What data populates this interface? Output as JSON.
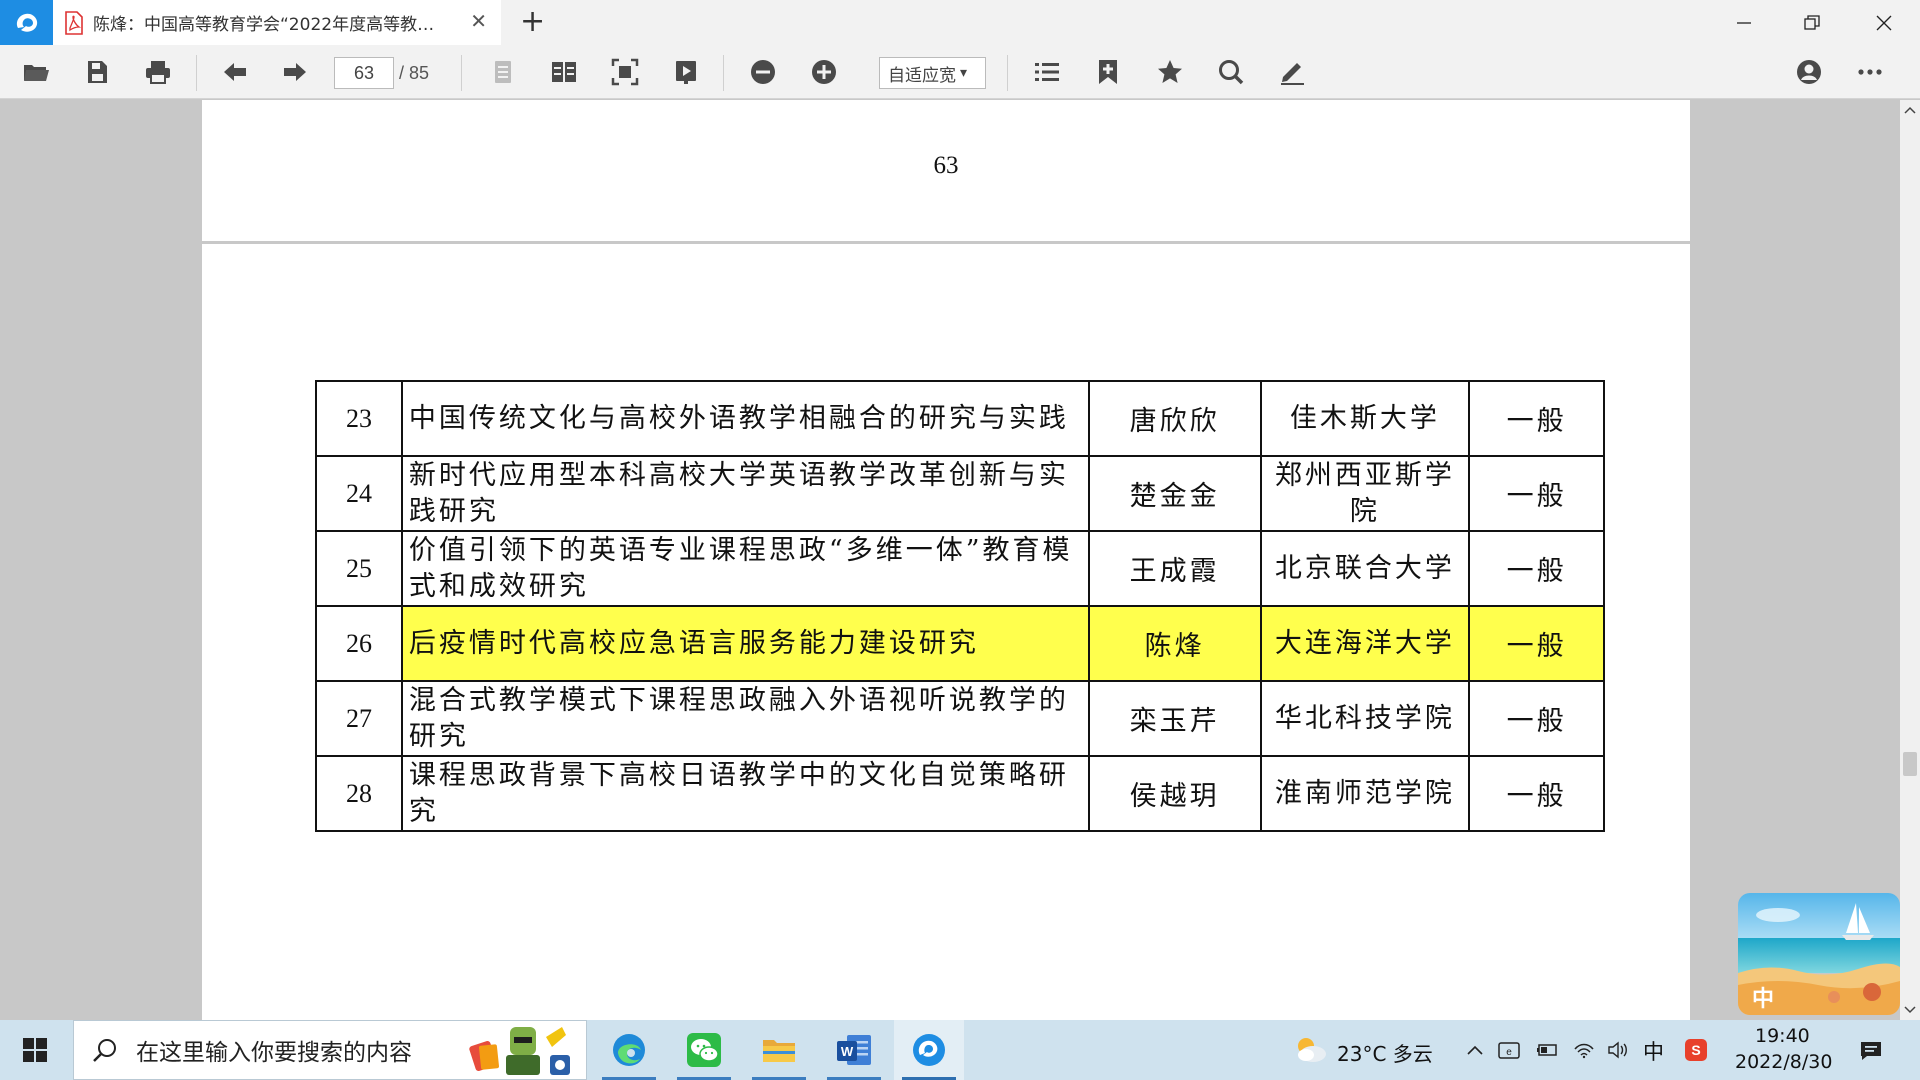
{
  "tab": {
    "title": "陈烽：中国高等教育学会“2022年度高等教…"
  },
  "toolbar": {
    "current_page": "63",
    "total_pages": "/ 85",
    "zoom_label": "自适应宽",
    "zoom_arrow": "▾"
  },
  "document": {
    "prev_page_number": "63",
    "rows": [
      {
        "no": "23",
        "title": "中国传统文化与高校外语教学相融合的研究与实践",
        "name": "唐欣欣",
        "unit": "佳木斯大学",
        "level": "一般",
        "highlight": false
      },
      {
        "no": "24",
        "title": "新时代应用型本科高校大学英语教学改革创新与实践研究",
        "name": "楚金金",
        "unit": "郑州西亚斯学院",
        "level": "一般",
        "highlight": false
      },
      {
        "no": "25",
        "title": "价值引领下的英语专业课程思政“多维一体”教育模式和成效研究",
        "name": "王成霞",
        "unit": "北京联合大学",
        "level": "一般",
        "highlight": false
      },
      {
        "no": "26",
        "title": "后疫情时代高校应急语言服务能力建设研究",
        "name": "陈烽",
        "unit": "大连海洋大学",
        "level": "一般",
        "highlight": true
      },
      {
        "no": "27",
        "title": "混合式教学模式下课程思政融入外语视听说教学的研究",
        "name": "栾玉芹",
        "unit": "华北科技学院",
        "level": "一般",
        "highlight": false
      },
      {
        "no": "28",
        "title": "课程思政背景下高校日语教学中的文化自觉策略研究",
        "name": "侯越玥",
        "unit": "淮南师范学院",
        "level": "一般",
        "highlight": false
      }
    ]
  },
  "taskbar": {
    "search_placeholder": "在这里输入你要搜索的内容",
    "weather": "23°C 多云",
    "ime": "中",
    "time": "19:40",
    "date": "2022/8/30"
  },
  "widget": {
    "label": "中"
  },
  "colors": {
    "accent": "#1e8de3",
    "highlight": "#ffff4d",
    "taskbar": "#cfe2ee"
  }
}
